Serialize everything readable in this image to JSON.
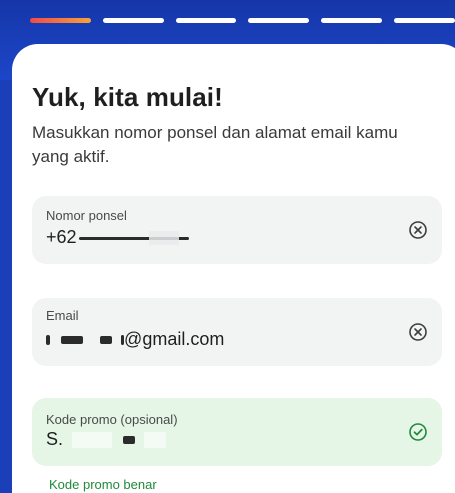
{
  "progress": {
    "total_steps": 6,
    "current_step": 1
  },
  "page": {
    "title": "Yuk, kita mulai!",
    "subtitle": "Masukkan nomor ponsel dan alamat email kamu yang aktif."
  },
  "fields": {
    "phone": {
      "label": "Nomor ponsel",
      "value_prefix": "+62",
      "icon": "clear-icon"
    },
    "email": {
      "label": "Email",
      "value_suffix": "@gmail.com",
      "icon": "clear-icon"
    },
    "promo": {
      "label": "Kode promo (opsional)",
      "value_prefix": "S.",
      "icon": "check-circle-icon",
      "status": "valid"
    }
  },
  "promo_hint": "Kode promo benar",
  "colors": {
    "accent_blue": "#1b3fb8",
    "success_green": "#1f8a3a",
    "success_bg": "#e5f5e6"
  }
}
